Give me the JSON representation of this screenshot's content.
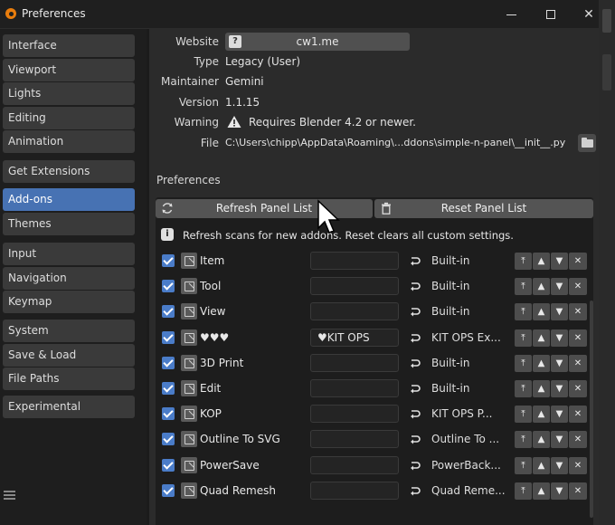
{
  "window": {
    "title": "Preferences"
  },
  "sidebar": {
    "groups": [
      [
        "Interface",
        "Viewport",
        "Lights",
        "Editing",
        "Animation"
      ],
      [
        "Get Extensions"
      ],
      [
        "Add-ons",
        "Themes"
      ],
      [
        "Input",
        "Navigation",
        "Keymap"
      ],
      [
        "System",
        "Save & Load",
        "File Paths"
      ],
      [
        "Experimental"
      ]
    ],
    "active": "Add-ons"
  },
  "addon_info": {
    "website_label": "Website",
    "website_value": "cw1.me",
    "type_label": "Type",
    "type_value": "Legacy (User)",
    "maintainer_label": "Maintainer",
    "maintainer_value": "Gemini",
    "version_label": "Version",
    "version_value": "1.1.15",
    "warning_label": "Warning",
    "warning_value": "Requires Blender 4.2 or newer.",
    "file_label": "File",
    "file_value": "C:\\Users\\chipp\\AppData\\Roaming\\...ddons\\simple-n-panel\\__init__.py"
  },
  "preferences": {
    "section_title": "Preferences",
    "refresh_label": "Refresh Panel List",
    "reset_label": "Reset Panel List",
    "info_message": "Refresh scans for new addons. Reset clears all custom settings.",
    "rows": [
      {
        "name": "Item",
        "field": "",
        "category": "Built-in"
      },
      {
        "name": "Tool",
        "field": "",
        "category": "Built-in"
      },
      {
        "name": "View",
        "field": "",
        "category": "Built-in"
      },
      {
        "name": "♥♥♥",
        "field": "♥KIT OPS",
        "category": "KIT OPS Ex..."
      },
      {
        "name": "3D Print",
        "field": "",
        "category": "Built-in"
      },
      {
        "name": "Edit",
        "field": "",
        "category": "Built-in"
      },
      {
        "name": "KOP",
        "field": "",
        "category": "KIT OPS P..."
      },
      {
        "name": "Outline To SVG",
        "field": "",
        "category": "Outline To ..."
      },
      {
        "name": "PowerSave",
        "field": "",
        "category": "PowerBack..."
      },
      {
        "name": "Quad Remesh",
        "field": "",
        "category": "Quad Reme..."
      }
    ]
  },
  "colors": {
    "accent": "#4772b3",
    "checkbox": "#4a7cc8",
    "logo": "#e87d0d"
  },
  "icons": {
    "row_controls": [
      "move-to-top-icon",
      "move-up-icon",
      "move-down-icon",
      "remove-icon"
    ]
  }
}
